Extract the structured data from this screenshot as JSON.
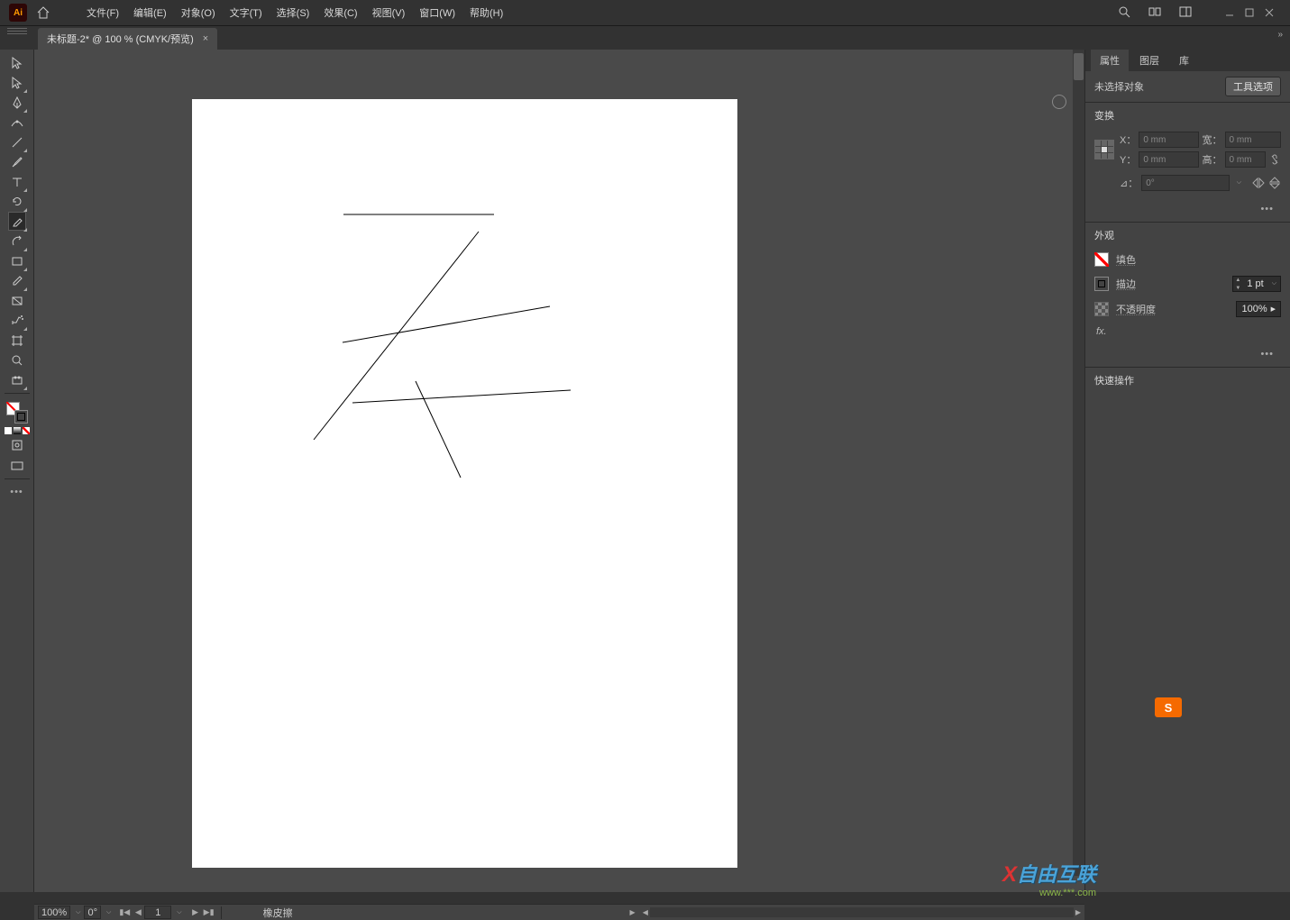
{
  "menubar": {
    "items": [
      "文件(F)",
      "编辑(E)",
      "对象(O)",
      "文字(T)",
      "选择(S)",
      "效果(C)",
      "视图(V)",
      "窗口(W)",
      "帮助(H)"
    ],
    "app_abbrev": "Ai"
  },
  "document": {
    "tab_title": "未标题-2* @ 100 % (CMYK/预览)"
  },
  "panels": {
    "tabs": [
      "属性",
      "图层",
      "库"
    ],
    "no_selection": "未选择对象",
    "tool_options_btn": "工具选项",
    "transform": {
      "title": "变换",
      "x_label": "X：",
      "y_label": "Y：",
      "w_label": "宽：",
      "h_label": "高：",
      "x_val": "0 mm",
      "y_val": "0 mm",
      "w_val": "0 mm",
      "h_val": "0 mm",
      "rotate_label": "⊿：",
      "rotate_val": "0°"
    },
    "appearance": {
      "title": "外观",
      "fill_label": "填色",
      "stroke_label": "描边",
      "stroke_weight": "1 pt",
      "opacity_label": "不透明度",
      "opacity_val": "100%",
      "fx_label": "fx."
    },
    "quick_actions": {
      "title": "快速操作"
    }
  },
  "statusbar": {
    "zoom": "100%",
    "rotation": "0°",
    "artboard_num": "1",
    "tool_name": "橡皮擦"
  },
  "watermark": {
    "text": "自由互联",
    "url": "www.***.com"
  },
  "ime": "S",
  "tools": [
    "selection-tool",
    "direct-selection-tool",
    "pen-tool",
    "curvature-tool",
    "line-tool",
    "paintbrush-tool",
    "type-tool",
    "rotate-tool",
    "eraser-tool",
    "scale-tool",
    "rectangle-tool",
    "eyedropper-tool",
    "gradient-tool",
    "symbol-sprayer-tool",
    "artboard-tool",
    "zoom-tool",
    "hand-tool"
  ]
}
